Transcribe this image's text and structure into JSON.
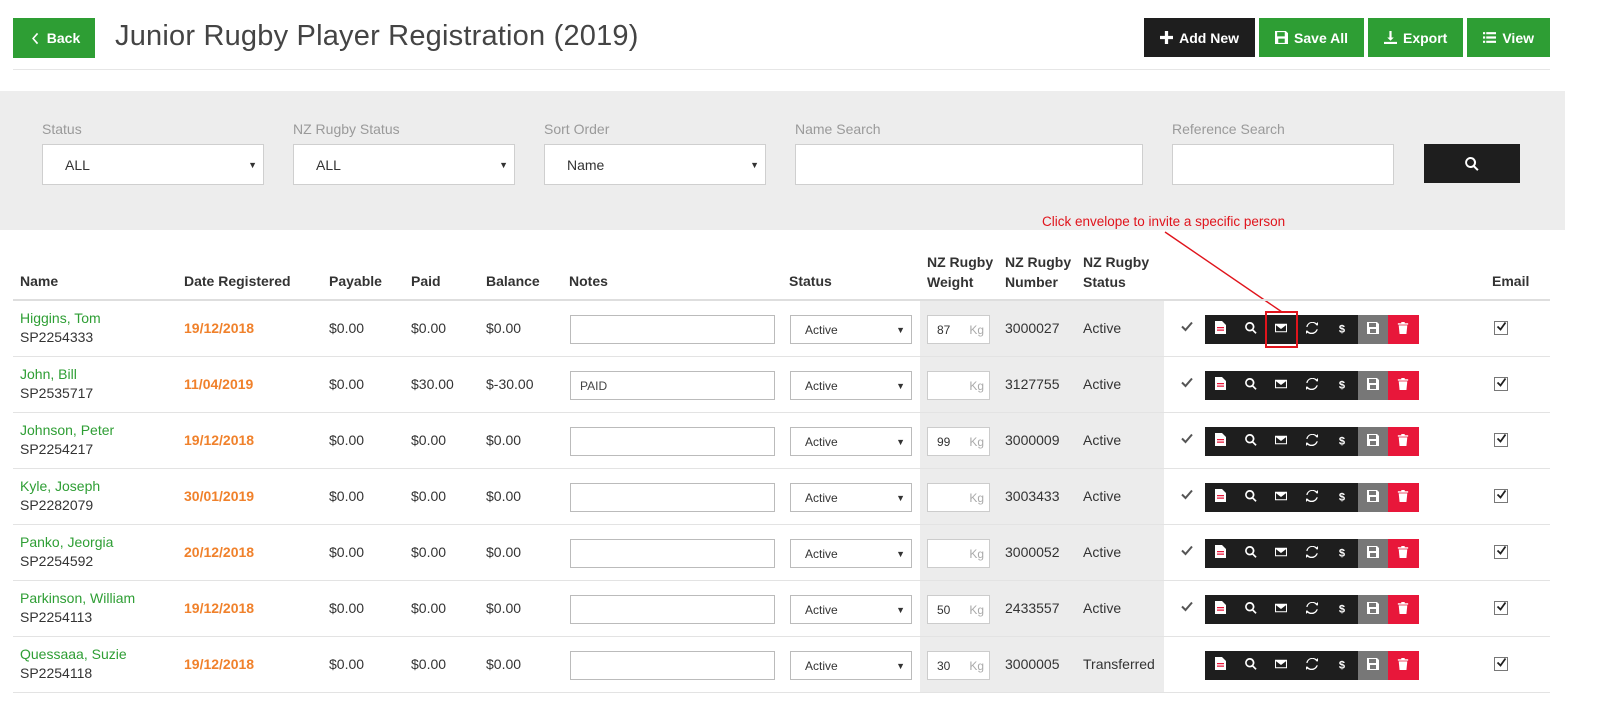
{
  "header": {
    "back_label": "Back",
    "title": "Junior Rugby Player Registration (2019)",
    "toolbar": {
      "add_new": "Add New",
      "save_all": "Save All",
      "export": "Export",
      "view": "View"
    }
  },
  "filters": {
    "status": {
      "label": "Status",
      "value": "ALL"
    },
    "nz_status": {
      "label": "NZ Rugby Status",
      "value": "ALL"
    },
    "sort_order": {
      "label": "Sort Order",
      "value": "Name"
    },
    "name_search": {
      "label": "Name Search",
      "value": ""
    },
    "reference_search": {
      "label": "Reference Search",
      "value": ""
    }
  },
  "annotation": {
    "text": "Click envelope to invite a specific person",
    "color": "#e0141c"
  },
  "table": {
    "headers": {
      "name": "Name",
      "date_registered": "Date Registered",
      "payable": "Payable",
      "paid": "Paid",
      "balance": "Balance",
      "notes": "Notes",
      "status": "Status",
      "weight_1": "NZ Rugby",
      "weight_2": "Weight",
      "number_1": "NZ Rugby",
      "number_2": "Number",
      "nzstatus_1": "NZ Rugby",
      "nzstatus_2": "Status",
      "email": "Email"
    },
    "weight_unit": "Kg",
    "rows": [
      {
        "name": "Higgins, Tom",
        "ref": "SP2254333",
        "date": "19/12/2018",
        "payable": "$0.00",
        "paid": "$0.00",
        "balance": "$0.00",
        "notes": "",
        "status": "Active",
        "weight": "87",
        "nz_number": "3000027",
        "nz_status": "Active",
        "verified": true,
        "email": true
      },
      {
        "name": "John, Bill",
        "ref": "SP2535717",
        "date": "11/04/2019",
        "payable": "$0.00",
        "paid": "$30.00",
        "balance": "$-30.00",
        "notes": "PAID",
        "status": "Active",
        "weight": "",
        "nz_number": "3127755",
        "nz_status": "Active",
        "verified": true,
        "email": true
      },
      {
        "name": "Johnson, Peter",
        "ref": "SP2254217",
        "date": "19/12/2018",
        "payable": "$0.00",
        "paid": "$0.00",
        "balance": "$0.00",
        "notes": "",
        "status": "Active",
        "weight": "99",
        "nz_number": "3000009",
        "nz_status": "Active",
        "verified": true,
        "email": true
      },
      {
        "name": "Kyle, Joseph",
        "ref": "SP2282079",
        "date": "30/01/2019",
        "payable": "$0.00",
        "paid": "$0.00",
        "balance": "$0.00",
        "notes": "",
        "status": "Active",
        "weight": "",
        "nz_number": "3003433",
        "nz_status": "Active",
        "verified": true,
        "email": true
      },
      {
        "name": "Panko, Jeorgia",
        "ref": "SP2254592",
        "date": "20/12/2018",
        "payable": "$0.00",
        "paid": "$0.00",
        "balance": "$0.00",
        "notes": "",
        "status": "Active",
        "weight": "",
        "nz_number": "3000052",
        "nz_status": "Active",
        "verified": true,
        "email": true
      },
      {
        "name": "Parkinson, William",
        "ref": "SP2254113",
        "date": "19/12/2018",
        "payable": "$0.00",
        "paid": "$0.00",
        "balance": "$0.00",
        "notes": "",
        "status": "Active",
        "weight": "50",
        "nz_number": "2433557",
        "nz_status": "Active",
        "verified": true,
        "email": true
      },
      {
        "name": "Quessaaa, Suzie",
        "ref": "SP2254118",
        "date": "19/12/2018",
        "payable": "$0.00",
        "paid": "$0.00",
        "balance": "$0.00",
        "notes": "",
        "status": "Active",
        "weight": "30",
        "nz_number": "3000005",
        "nz_status": "Transferred",
        "verified": false,
        "email": true
      }
    ]
  },
  "colors": {
    "green": "#2e9e34",
    "dark": "#1e1e1e",
    "date_orange": "#f0812b",
    "delete_red": "#e8173a"
  }
}
